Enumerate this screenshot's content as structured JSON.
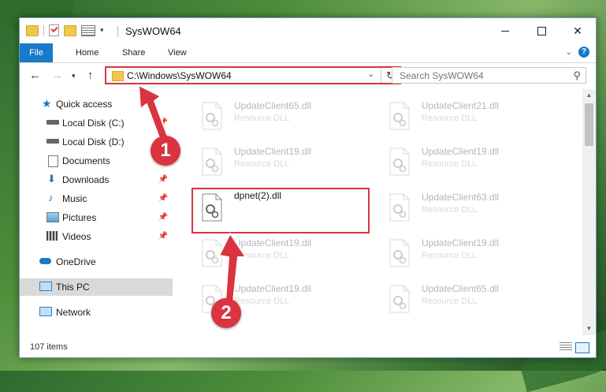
{
  "window": {
    "title": "SysWOW64"
  },
  "ribbon": {
    "tabs": [
      "File",
      "Home",
      "Share",
      "View"
    ],
    "help": "?"
  },
  "address": {
    "path": "C:\\Windows\\SysWOW64",
    "search_placeholder": "Search SysWOW64"
  },
  "sidebar": {
    "items": [
      {
        "label": "Quick access",
        "icon": "star-icon",
        "pinned": false
      },
      {
        "label": "Local Disk (C:)",
        "icon": "drive-icon",
        "pinned": true
      },
      {
        "label": "Local Disk (D:)",
        "icon": "drive-icon",
        "pinned": false
      },
      {
        "label": "Documents",
        "icon": "documents-icon",
        "pinned": true
      },
      {
        "label": "Downloads",
        "icon": "download-icon",
        "pinned": true
      },
      {
        "label": "Music",
        "icon": "music-icon",
        "pinned": true
      },
      {
        "label": "Pictures",
        "icon": "pictures-icon",
        "pinned": true
      },
      {
        "label": "Videos",
        "icon": "videos-icon",
        "pinned": true
      },
      {
        "label": "OneDrive",
        "icon": "cloud-icon",
        "pinned": false
      },
      {
        "label": "This PC",
        "icon": "computer-icon",
        "pinned": false,
        "selected": true
      },
      {
        "label": "Network",
        "icon": "network-icon",
        "pinned": false
      }
    ]
  },
  "files": [
    {
      "name": "UpdateClient65.dll",
      "type": "Resource DLL"
    },
    {
      "name": "UpdateClient21.dll",
      "type": "Resource DLL"
    },
    {
      "name": "UpdateClient19.dll",
      "type": "Resource DLL"
    },
    {
      "name": "UpdateClient19.dll",
      "type": "Resource DLL"
    },
    {
      "name": "dpnet(2).dll",
      "type": ""
    },
    {
      "name": "UpdateClient63.dll",
      "type": "Resource DLL"
    },
    {
      "name": "UpdateClient19.dll",
      "type": "Resource DLL"
    },
    {
      "name": "UpdateClient19.dll",
      "type": "Resource DLL"
    },
    {
      "name": "UpdateClient19.dll",
      "type": "Resource DLL"
    },
    {
      "name": "UpdateClient65.dll",
      "type": "Resource DLL"
    }
  ],
  "status": {
    "item_count": "107 items"
  },
  "annotations": {
    "step1": "1",
    "step2": "2",
    "color": "#d9343f"
  }
}
